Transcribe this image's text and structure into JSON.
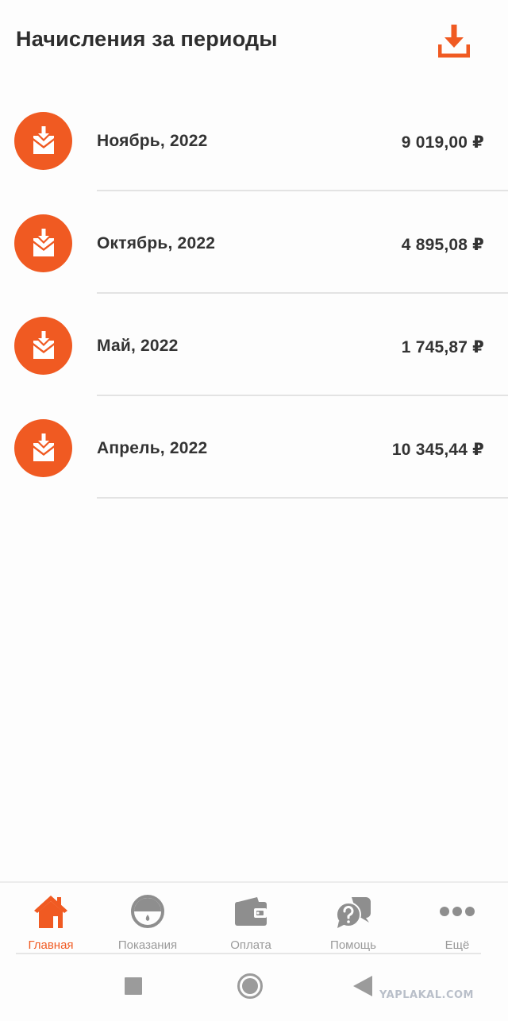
{
  "header": {
    "title": "Начисления за периоды",
    "download_icon": "download-icon"
  },
  "colors": {
    "accent": "#f05a22",
    "text": "#333333",
    "nav_inactive": "#9a9a9a",
    "divider": "#e3e3e3"
  },
  "periods": [
    {
      "label": "Ноябрь, 2022",
      "amount": "9 019,00 ₽",
      "icon": "envelope-download-icon"
    },
    {
      "label": "Октябрь, 2022",
      "amount": "4 895,08 ₽",
      "icon": "envelope-download-icon"
    },
    {
      "label": "Май, 2022",
      "amount": "1 745,87 ₽",
      "icon": "envelope-download-icon"
    },
    {
      "label": "Апрель, 2022",
      "amount": "10 345,44 ₽",
      "icon": "envelope-download-icon"
    }
  ],
  "bottom_nav": {
    "items": [
      {
        "label": "Главная",
        "icon": "home-icon",
        "active": true
      },
      {
        "label": "Показания",
        "icon": "meter-icon",
        "active": false
      },
      {
        "label": "Оплата",
        "icon": "wallet-icon",
        "active": false
      },
      {
        "label": "Помощь",
        "icon": "help-chat-icon",
        "active": false
      },
      {
        "label": "Ещё",
        "icon": "more-dots-icon",
        "active": false
      }
    ]
  },
  "system_bar": {
    "watermark": "YAPLAKAL.COM"
  }
}
